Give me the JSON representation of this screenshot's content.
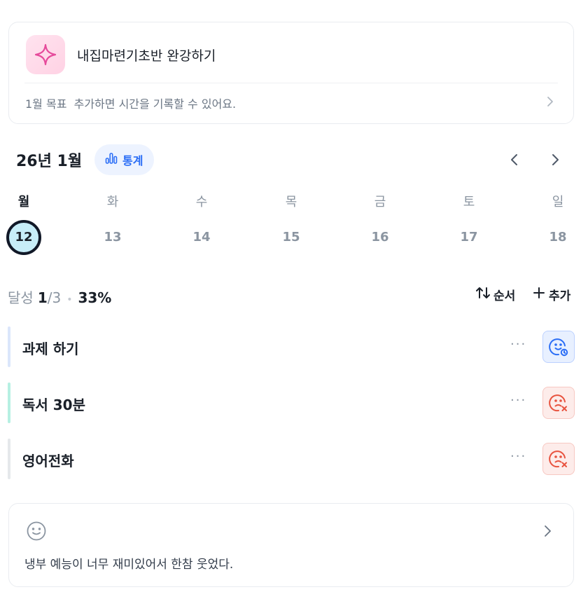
{
  "goal": {
    "title": "내집마련기초반 완강하기",
    "hint": "1월 목표  추가하면 시간을 기록할 수 있어요.",
    "icon": "sparkle-icon"
  },
  "calendar": {
    "month_label": "26년 1월",
    "stats_label": "통계",
    "days": [
      {
        "name": "월",
        "num": "12",
        "selected": true
      },
      {
        "name": "화",
        "num": "13",
        "selected": false
      },
      {
        "name": "수",
        "num": "14",
        "selected": false
      },
      {
        "name": "목",
        "num": "15",
        "selected": false
      },
      {
        "name": "금",
        "num": "16",
        "selected": false
      },
      {
        "name": "토",
        "num": "17",
        "selected": false
      },
      {
        "name": "일",
        "num": "18",
        "selected": false
      }
    ]
  },
  "progress": {
    "label": "달성",
    "done": "1",
    "total": "/3",
    "percent": "33%"
  },
  "toolbar": {
    "order_label": "순서",
    "add_label": "추가"
  },
  "tasks": [
    {
      "label": "과제 하기",
      "bar_color": "#dbe6fb",
      "status": "pending",
      "status_icon": "smile-clock-icon"
    },
    {
      "label": "독서 30분",
      "bar_color": "#b6f0e2",
      "status": "failed",
      "status_icon": "sad-x-icon"
    },
    {
      "label": "영어전화",
      "bar_color": "#e5e8eb",
      "status": "failed",
      "status_icon": "sad-x-icon"
    }
  ],
  "memo": {
    "text": "냉부 예능이 너무 재미있어서 한참 웃었다.",
    "icon": "smile-face-icon"
  },
  "colors": {
    "accent_blue": "#2b6ef6",
    "status_red": "#e8533f",
    "today_ring": "#111827",
    "today_fill": "#c7edf8"
  }
}
